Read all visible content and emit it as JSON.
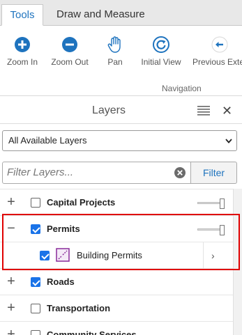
{
  "tabs": [
    {
      "label": "Tools",
      "active": true
    },
    {
      "label": "Draw and Measure",
      "active": false
    }
  ],
  "tools": [
    {
      "label": "Zoom In",
      "icon": "zoom-in-icon"
    },
    {
      "label": "Zoom Out",
      "icon": "zoom-out-icon"
    },
    {
      "label": "Pan",
      "icon": "hand-icon"
    },
    {
      "label": "Initial View",
      "icon": "refresh-icon"
    },
    {
      "label": "Previous Exter",
      "icon": "arrow-left-icon"
    }
  ],
  "tool_group_label": "Navigation",
  "panel": {
    "title": "Layers",
    "select_value": "All Available Layers",
    "filter_placeholder": "Filter Layers...",
    "filter_button": "Filter"
  },
  "layers": [
    {
      "name": "Capital Projects",
      "checked": false,
      "expanded": false,
      "expander": "+"
    },
    {
      "name": "Permits",
      "checked": true,
      "expanded": true,
      "expander": "−"
    },
    {
      "name": "Building Permits",
      "checked": true,
      "child": true
    },
    {
      "name": "Roads",
      "checked": true,
      "expanded": false,
      "expander": "+"
    },
    {
      "name": "Transportation",
      "checked": false,
      "expanded": false,
      "expander": "+"
    },
    {
      "name": "Community Services",
      "checked": false,
      "expanded": false,
      "expander": "+"
    }
  ],
  "colors": {
    "accent": "#1e73be",
    "checkbox": "#1a73e8",
    "highlight": "#e00000"
  }
}
